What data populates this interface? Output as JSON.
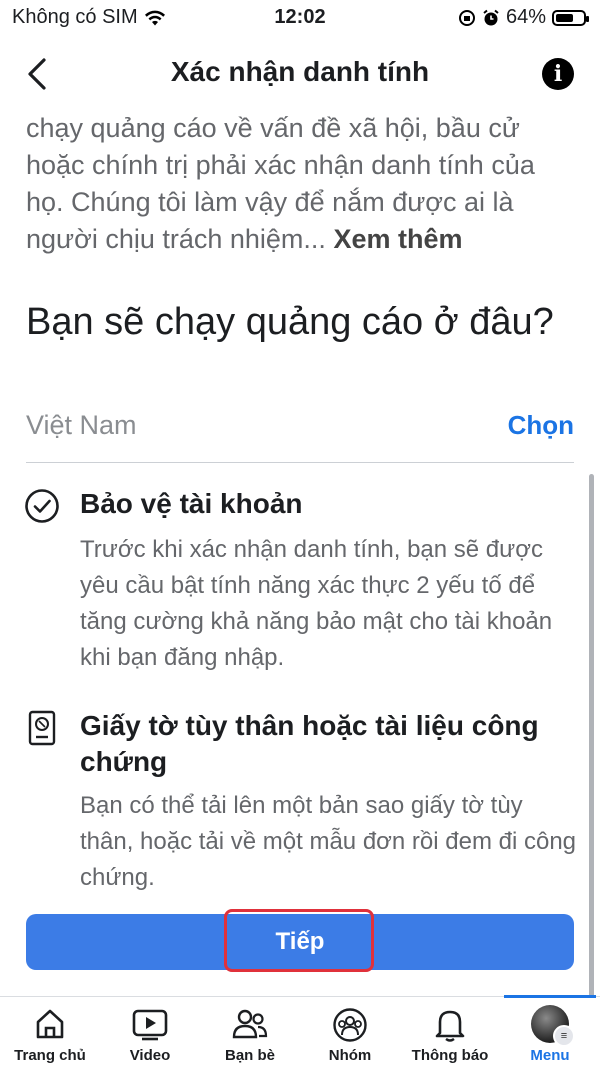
{
  "status_bar": {
    "carrier": "Không có SIM",
    "time": "12:02",
    "battery": "64%",
    "battery_level": 0.64
  },
  "header": {
    "title": "Xác nhận danh tính",
    "back_icon": "chevron-left-icon",
    "info_icon": "info-icon"
  },
  "intro": {
    "text": "chạy quảng cáo về vấn đề xã hội, bầu cử hoặc chính trị phải xác nhận danh tính của họ. Chúng tôi làm vậy để nắm được ai là người chịu trách nhiệm...",
    "see_more": "Xem thêm"
  },
  "location": {
    "question": "Bạn sẽ chạy quảng cáo ở đâu?",
    "country": "Việt Nam",
    "choose_label": "Chọn"
  },
  "sections": [
    {
      "icon": "check-circle-icon",
      "title": "Bảo vệ tài khoản",
      "description": "Trước khi xác nhận danh tính, bạn sẽ được yêu cầu bật tính năng xác thực 2 yếu tố để tăng cường khả năng bảo mật cho tài khoản khi bạn đăng nhập."
    },
    {
      "icon": "id-document-icon",
      "title": "Giấy tờ tùy thân hoặc tài liệu công chứng",
      "description": "Bạn có thể tải lên một bản sao giấy tờ tùy thân, hoặc tải về một mẫu đơn rồi đem đi công chứng."
    }
  ],
  "button": {
    "label": "Tiếp"
  },
  "tabs": [
    {
      "label": "Trang chủ",
      "icon": "home-icon"
    },
    {
      "label": "Video",
      "icon": "video-icon"
    },
    {
      "label": "Bạn bè",
      "icon": "friends-icon"
    },
    {
      "label": "Nhóm",
      "icon": "groups-icon"
    },
    {
      "label": "Thông báo",
      "icon": "bell-icon"
    },
    {
      "label": "Menu",
      "icon": "avatar",
      "active": true
    }
  ],
  "colors": {
    "accent": "#1b74e4",
    "button": "#3c7ce6",
    "highlight": "#e0313b"
  }
}
